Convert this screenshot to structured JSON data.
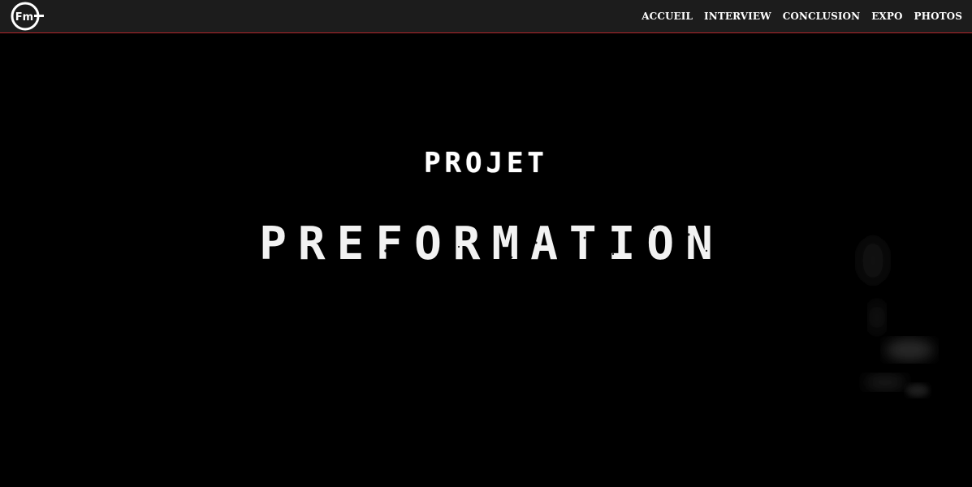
{
  "header": {
    "logo_icon": "fm-logo-icon",
    "accent_color": "#b3262a",
    "nav": [
      {
        "label": "ACCUEIL"
      },
      {
        "label": "INTERVIEW"
      },
      {
        "label": "CONCLUSION"
      },
      {
        "label": "EXPO"
      },
      {
        "label": "PHOTOS"
      }
    ]
  },
  "hero": {
    "subtitle": "PROJET",
    "title": "PREFORMATION"
  }
}
